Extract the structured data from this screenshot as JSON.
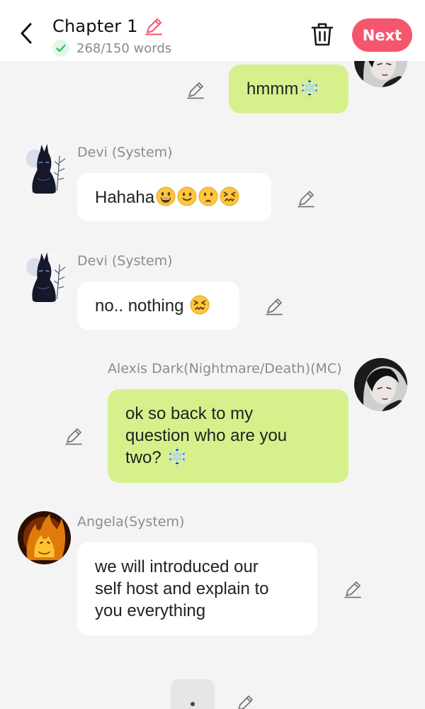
{
  "header": {
    "chapter_title": "Chapter 1",
    "word_count": "268/150 words",
    "next_label": "Next"
  },
  "messages": [
    {
      "sender": "",
      "text": "hmmm",
      "side": "right",
      "emojis": [
        "snowflake"
      ]
    },
    {
      "sender": "Devi (System)",
      "text": "Hahaha",
      "side": "left",
      "emojis": [
        "grinning-face",
        "slightly-smiling-face",
        "frowning-face",
        "confounded-face"
      ]
    },
    {
      "sender": "Devi (System)",
      "text": "no.. nothing ",
      "side": "left",
      "emojis": [
        "confounded-face"
      ]
    },
    {
      "sender": "Alexis Dark(Nightmare/Death)(MC)",
      "text_lines": [
        "ok so back to my",
        "question who are you",
        "two? "
      ],
      "side": "right",
      "emojis": [
        "snowflake"
      ]
    },
    {
      "sender": "Angela(System)",
      "text_lines": [
        "we will introduced our",
        "self host and explain to",
        "you everything"
      ],
      "side": "left"
    }
  ],
  "colors": {
    "accent": "#f4566e",
    "my_bubble": "#d6f18b",
    "their_bubble": "#ffffff",
    "background": "#f4f4f4",
    "check_green": "#3dbb5b"
  },
  "icons": [
    "back-arrow-icon",
    "pencil-icon",
    "check-icon",
    "trash-icon",
    "snowflake-emoji",
    "grinning-face-emoji",
    "slightly-smiling-face-emoji",
    "frowning-face-emoji",
    "confounded-face-emoji"
  ]
}
